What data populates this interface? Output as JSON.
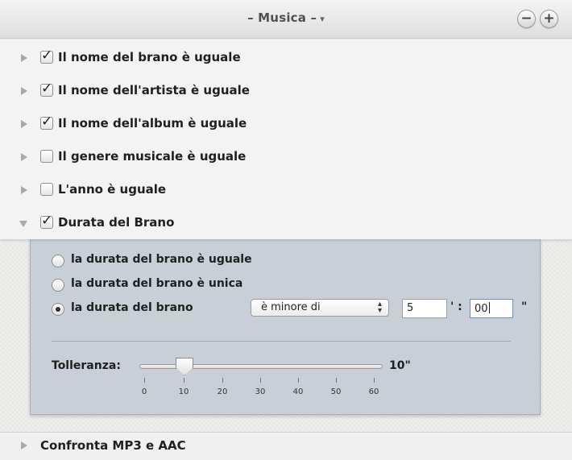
{
  "header": {
    "title": "– Musica –",
    "dropdown_glyph": "▾",
    "remove_glyph": "−",
    "add_glyph": "+"
  },
  "criteria": [
    {
      "label": "Il nome del brano è uguale",
      "checked": true,
      "expanded": false
    },
    {
      "label": "Il nome dell'artista è uguale",
      "checked": true,
      "expanded": false
    },
    {
      "label": "Il nome dell'album è uguale",
      "checked": true,
      "expanded": false
    },
    {
      "label": "Il genere musicale è uguale",
      "checked": false,
      "expanded": false
    },
    {
      "label": "L'anno è uguale",
      "checked": false,
      "expanded": false
    },
    {
      "label": "Durata del Brano",
      "checked": true,
      "expanded": true
    }
  ],
  "duration": {
    "options": [
      {
        "label": "la durata del brano è uguale",
        "selected": false
      },
      {
        "label": "la durata del brano è unica",
        "selected": false
      },
      {
        "label": "la durata del brano",
        "selected": true
      }
    ],
    "comparison": "è minore di",
    "minutes": "5",
    "minutes_mark": "' :",
    "seconds": "00",
    "seconds_mark": "\"",
    "tolerance_label": "Tolleranza:",
    "tolerance_value": "10\"",
    "tolerance_level": 10,
    "ticks": [
      "0",
      "10",
      "20",
      "30",
      "40",
      "50",
      "60"
    ]
  },
  "bottom": {
    "label": "Confronta MP3 e AAC"
  },
  "colors": {
    "panel_bg": "#c9cfd6",
    "list_bg": "#f3f3f3",
    "accent_focus": "#6d8fbf"
  },
  "icons": {
    "collapsed": "disclosure-triangle-right-icon",
    "expanded": "disclosure-triangle-down-icon",
    "remove": "minus-circle-icon",
    "add": "plus-circle-icon"
  }
}
